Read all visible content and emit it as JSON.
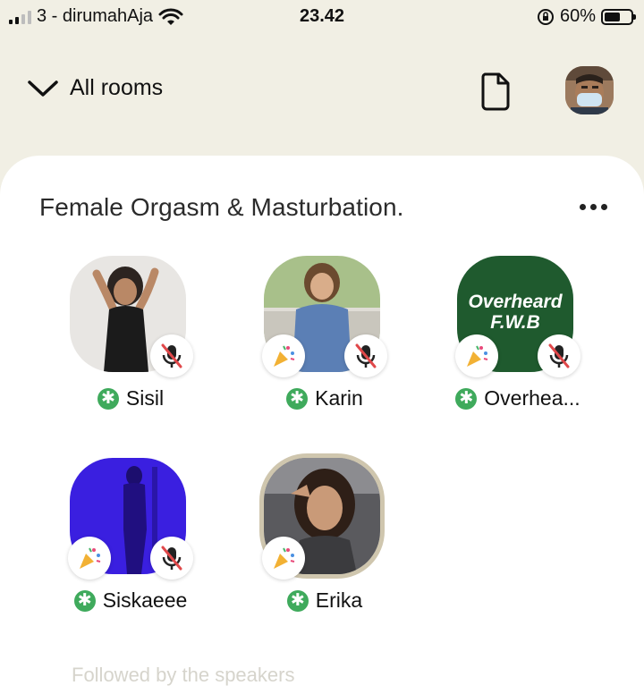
{
  "status_bar": {
    "carrier": "3 - dirumahAja",
    "time": "23.42",
    "battery": "60%",
    "battery_level": 0.6
  },
  "header": {
    "all_rooms_label": "All rooms",
    "icons": [
      "chevron-down-icon",
      "document-icon",
      "profile-avatar"
    ]
  },
  "room": {
    "title": "Female Orgasm & Masturbation.",
    "speakers": [
      {
        "name": "Sisil",
        "moderator": true,
        "muted": true,
        "party_badge": false
      },
      {
        "name": "Karin",
        "moderator": true,
        "muted": true,
        "party_badge": true
      },
      {
        "name": "Overhea...",
        "moderator": true,
        "muted": true,
        "party_badge": true,
        "avatar_text": "Overheard F.W.B"
      },
      {
        "name": "Siskaeee",
        "moderator": true,
        "muted": true,
        "party_badge": true
      },
      {
        "name": "Erika",
        "moderator": true,
        "muted": false,
        "party_badge": true,
        "speaking": true
      }
    ],
    "followed_label": "Followed by the speakers"
  },
  "colors": {
    "background": "#f1efe4",
    "moderator_green": "#3faa5c",
    "mute_red": "#e0484a"
  }
}
